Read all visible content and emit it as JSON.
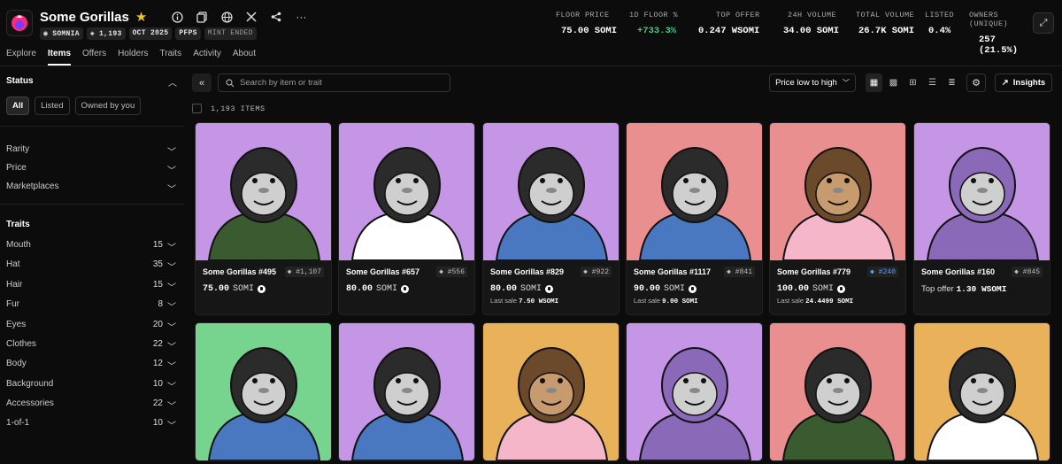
{
  "collection": {
    "title": "Some Gorillas",
    "chips": [
      "SOMNIA",
      "1,193",
      "OCT 2025",
      "PFPS",
      "MINT ENDED"
    ]
  },
  "stats": [
    {
      "label": "FLOOR PRICE",
      "value": "75.00 SOMI",
      "color": "white"
    },
    {
      "label": "1D FLOOR %",
      "value": "+733.3%",
      "color": "green"
    },
    {
      "label": "TOP OFFER",
      "value": "0.247 WSOMI",
      "color": "white"
    },
    {
      "label": "24H VOLUME",
      "value": "34.00 SOMI",
      "color": "white"
    },
    {
      "label": "TOTAL VOLUME",
      "value": "26.7K SOMI",
      "color": "white"
    },
    {
      "label": "LISTED",
      "value": "0.4%",
      "color": "white"
    },
    {
      "label": "OWNERS (UNIQUE)",
      "value": "257 (21.5%)",
      "color": "white"
    }
  ],
  "nav": [
    "Explore",
    "Items",
    "Offers",
    "Holders",
    "Traits",
    "Activity",
    "About"
  ],
  "sidebar": {
    "status_title": "Status",
    "status_buttons": [
      "All",
      "Listed",
      "Owned by you"
    ],
    "filters": [
      "Rarity",
      "Price",
      "Marketplaces"
    ],
    "traits_title": "Traits",
    "traits": [
      {
        "name": "Mouth",
        "count": "15"
      },
      {
        "name": "Hat",
        "count": "35"
      },
      {
        "name": "Hair",
        "count": "15"
      },
      {
        "name": "Fur",
        "count": "8"
      },
      {
        "name": "Eyes",
        "count": "20"
      },
      {
        "name": "Clothes",
        "count": "22"
      },
      {
        "name": "Body",
        "count": "12"
      },
      {
        "name": "Background",
        "count": "10"
      },
      {
        "name": "Accessories",
        "count": "22"
      },
      {
        "name": "1-of-1",
        "count": "10"
      }
    ]
  },
  "toolbar": {
    "search_placeholder": "Search by item or trait",
    "sort_label": "Price low to high",
    "insights_label": "Insights",
    "item_count": "1,193 ITEMS"
  },
  "items": [
    {
      "name": "Some Gorillas #495",
      "rank": "#1,107",
      "price": "75.00",
      "currency": "SOMI",
      "last_sale_label": "",
      "last_sale": "",
      "bg": "#c596e6"
    },
    {
      "name": "Some Gorillas #657",
      "rank": "#556",
      "price": "80.00",
      "currency": "SOMI",
      "last_sale_label": "",
      "last_sale": "",
      "bg": "#c596e6"
    },
    {
      "name": "Some Gorillas #829",
      "rank": "#922",
      "price": "80.00",
      "currency": "SOMI",
      "last_sale_label": "Last sale",
      "last_sale": "7.50 WSOMI",
      "bg": "#c596e6"
    },
    {
      "name": "Some Gorillas #1117",
      "rank": "#841",
      "price": "90.00",
      "currency": "SOMI",
      "last_sale_label": "Last sale",
      "last_sale": "9.00 SOMI",
      "bg": "#e98f8f"
    },
    {
      "name": "Some Gorillas #779",
      "rank": "#240",
      "price": "100.00",
      "currency": "SOMI",
      "last_sale_label": "Last sale",
      "last_sale": "24.4499 SOMI",
      "bg": "#e98f8f",
      "rank_blue": true
    },
    {
      "name": "Some Gorillas #160",
      "rank": "#845",
      "offer_label": "Top offer",
      "offer": "1.30 WSOMI",
      "bg": "#c596e6"
    }
  ],
  "row2_bgs": [
    "#77d48f",
    "#c596e6",
    "#e9b15a",
    "#c596e6",
    "#e98f8f",
    "#e9b15a"
  ]
}
